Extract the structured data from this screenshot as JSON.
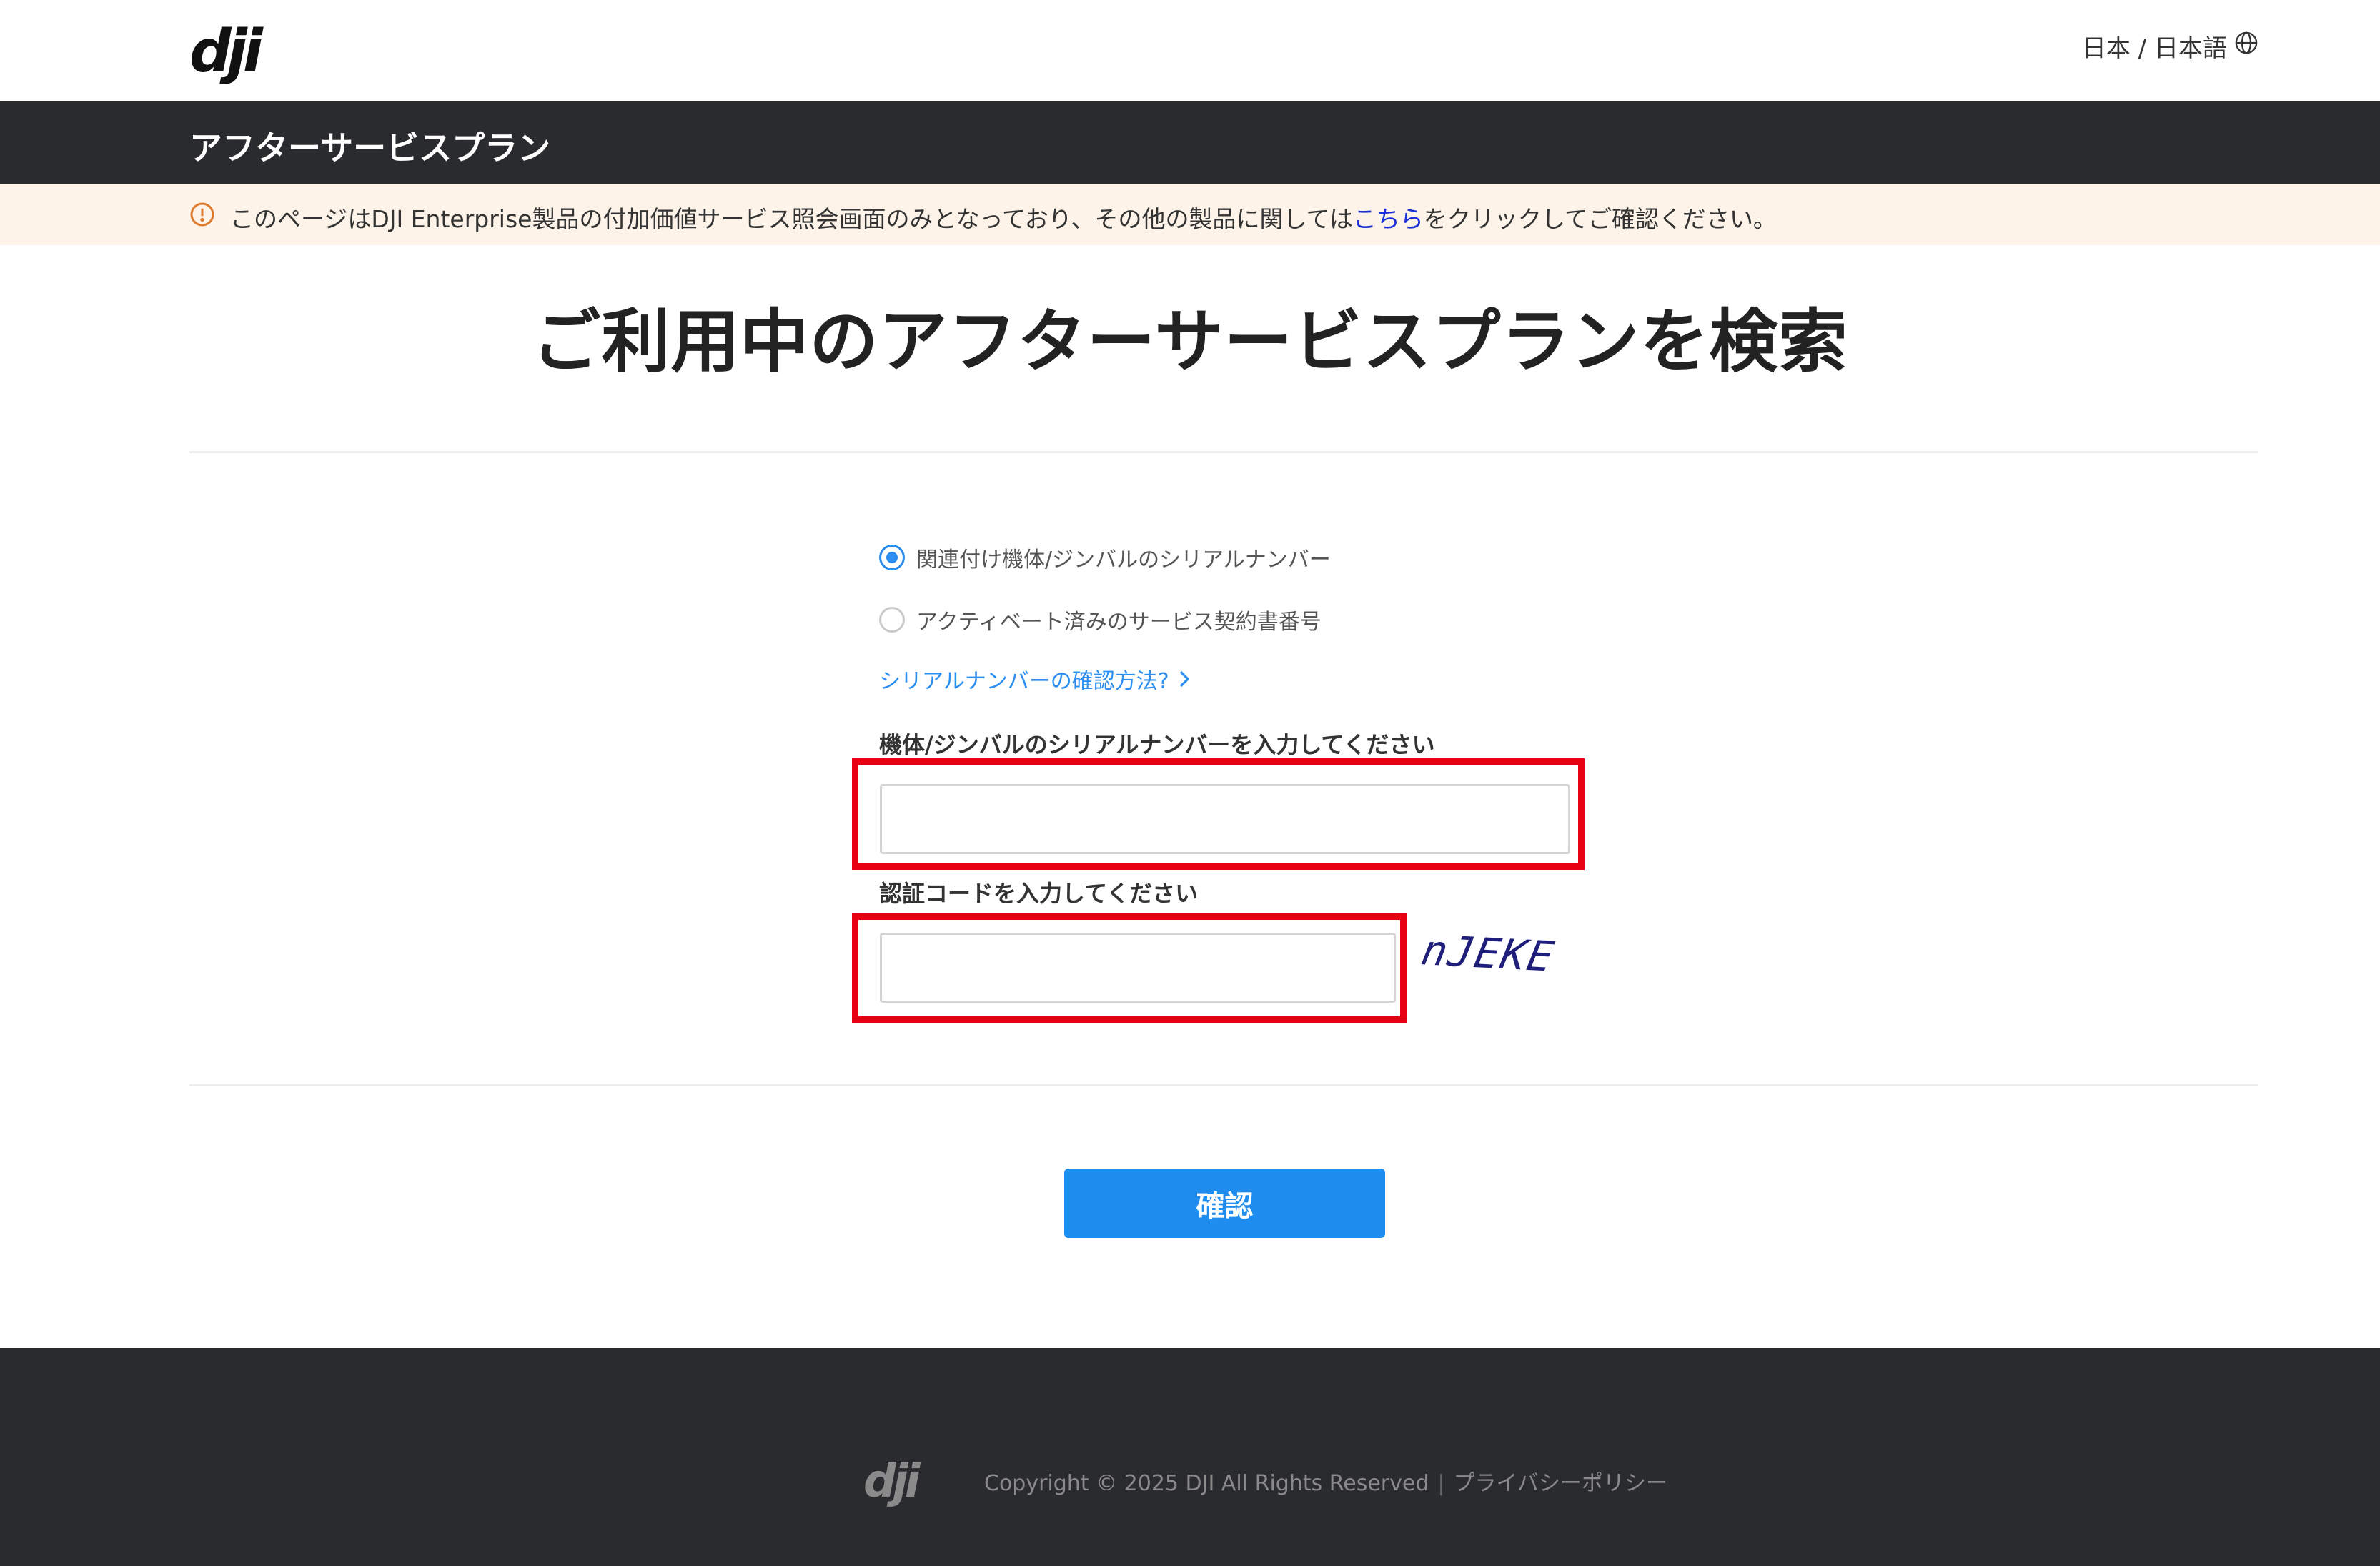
{
  "header": {
    "logo_text": "dji",
    "language_label": "日本 / 日本語",
    "language_icon": "globe-icon"
  },
  "banner": {
    "title": "アフターサービスプラン"
  },
  "notice": {
    "icon": "warning-circle-icon",
    "text_before": "このページはDJI Enterprise製品の付加価値サービス照会画面のみとなっており、その他の製品に関しては",
    "link_text": "こちら",
    "text_after": "をクリックしてご確認ください。",
    "accent_color": "#e07a2b"
  },
  "main": {
    "heading": "ご利用中のアフターサービスプランを検索",
    "search_options": [
      {
        "label": "関連付け機体/ジンバルのシリアルナンバー",
        "selected": true
      },
      {
        "label": "アクティベート済みのサービス契約書番号",
        "selected": false
      }
    ],
    "help_link": "シリアルナンバーの確認方法?",
    "serial_field": {
      "label": "機体/ジンバルのシリアルナンバーを入力してください",
      "value": "",
      "placeholder": ""
    },
    "code_field": {
      "label": "認証コードを入力してください",
      "value": "",
      "placeholder": ""
    },
    "captcha_text": "nJEKE",
    "confirm_button": "確認",
    "button_color": "#1f8df0",
    "highlight_color": "#e60012"
  },
  "footer": {
    "logo_text": "dji",
    "copyright": "Copyright © 2025 DJI All Rights Reserved",
    "separator": "|",
    "privacy_link": "プライバシーポリシー"
  }
}
